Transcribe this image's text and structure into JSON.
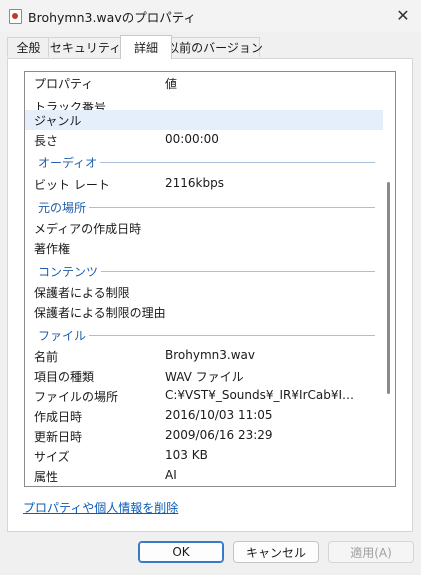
{
  "window": {
    "title": "Brohymn3.wavのプロパティ",
    "close_glyph": "✕"
  },
  "tabs": [
    {
      "label": "全般"
    },
    {
      "label": "セキュリティ"
    },
    {
      "label": "詳細",
      "active": true
    },
    {
      "label": "以前のバージョン"
    }
  ],
  "columns": {
    "name": "プロパティ",
    "value": "値"
  },
  "rows": {
    "track_number": {
      "name": "トラック番号",
      "value": ""
    },
    "genre": {
      "name": "ジャンル",
      "value": ""
    },
    "length": {
      "name": "長さ",
      "value": "00:00:00"
    },
    "bitrate": {
      "name": "ビット レート",
      "value": "2116kbps"
    },
    "media_created": {
      "name": "メディアの作成日時",
      "value": ""
    },
    "copyright": {
      "name": "著作権",
      "value": ""
    },
    "parental_rating": {
      "name": "保護者による制限",
      "value": ""
    },
    "parental_reason": {
      "name": "保護者による制限の理由",
      "value": ""
    },
    "file_name": {
      "name": "名前",
      "value": "Brohymn3.wav"
    },
    "item_type": {
      "name": "項目の種類",
      "value": "WAV ファイル"
    },
    "folder_path": {
      "name": "ファイルの場所",
      "value": "C:¥VST¥_Sounds¥_IR¥IrCab¥Impul..."
    },
    "date_created": {
      "name": "作成日時",
      "value": "2016/10/03 11:05"
    },
    "date_modified": {
      "name": "更新日時",
      "value": "2009/06/16 23:29"
    },
    "size": {
      "name": "サイズ",
      "value": "103 KB"
    },
    "attributes": {
      "name": "属性",
      "value": "AI"
    }
  },
  "groups": {
    "audio": "オーディオ",
    "origin": "元の場所",
    "content": "コンテンツ",
    "file": "ファイル"
  },
  "remove_link": "プロパティや個人情報を削除",
  "buttons": {
    "ok": "OK",
    "cancel": "キャンセル",
    "apply": "適用(A)"
  }
}
